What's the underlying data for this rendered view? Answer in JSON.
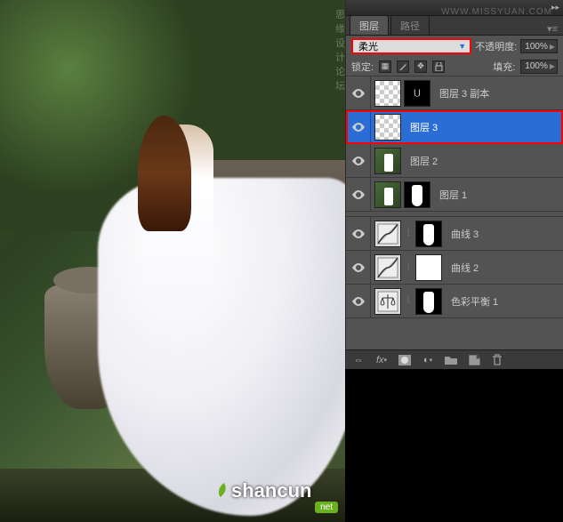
{
  "watermarks": {
    "top_text": "思缘设计论坛",
    "top_url": "WWW.MISSYUAN.COM",
    "bottom_brand": "shancun",
    "bottom_tag": "net"
  },
  "panel": {
    "tabs": {
      "active": "图层",
      "inactive": "路径"
    },
    "blend_mode": "柔光",
    "opacity": {
      "label": "不透明度:",
      "value": "100%"
    },
    "lock": {
      "label": "锁定:"
    },
    "fill": {
      "label": "填充:",
      "value": "100%"
    },
    "layers": [
      {
        "name": "图层 3 副本",
        "selected": false,
        "visible": true,
        "thumbs": [
          "trans",
          "mask_u"
        ]
      },
      {
        "name": "图层 3",
        "selected": true,
        "visible": true,
        "thumbs": [
          "trans"
        ],
        "highlighted": true
      },
      {
        "name": "图层 2",
        "selected": false,
        "visible": true,
        "thumbs": [
          "img"
        ]
      },
      {
        "name": "图层 1",
        "selected": false,
        "visible": true,
        "thumbs": [
          "img",
          "mask_silhouette"
        ]
      },
      {
        "name": "曲线 3",
        "selected": false,
        "visible": true,
        "thumbs": [
          "curves",
          "mask_silhouette"
        ],
        "linked": true
      },
      {
        "name": "曲线 2",
        "selected": false,
        "visible": true,
        "thumbs": [
          "curves",
          "mask_w"
        ],
        "linked": true
      },
      {
        "name": "色彩平衡 1",
        "selected": false,
        "visible": true,
        "thumbs": [
          "scales",
          "mask_silhouette"
        ],
        "linked": true
      }
    ]
  }
}
